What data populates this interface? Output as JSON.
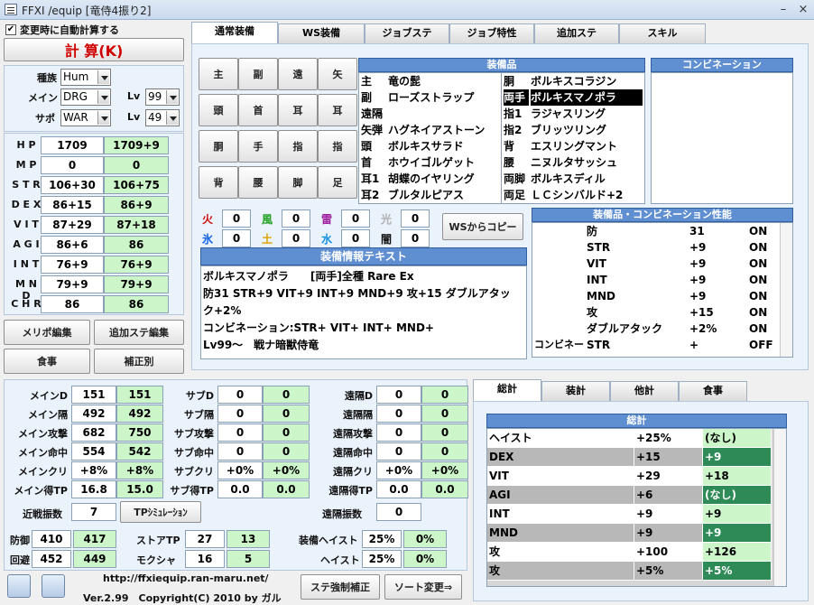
{
  "window": {
    "title": "FFXI /equip [竜侍4振り2]",
    "minimize": "–",
    "close": "×"
  },
  "top_left": {
    "auto_calc_label": "変更時に自動計算する",
    "auto_calc_checked": true,
    "calc_button": "計 算(K)"
  },
  "job": {
    "race_label": "種族",
    "race": "Hum",
    "main_label": "メイン",
    "main": "DRG",
    "sub_label": "サポ",
    "sub": "WAR",
    "lv_label": "Lv",
    "main_lv": "99",
    "sub_lv": "49"
  },
  "stats": [
    {
      "label": "H P",
      "base": "1709",
      "total": "1709+9"
    },
    {
      "label": "M P",
      "base": "0",
      "total": "0"
    },
    {
      "label": "S T R",
      "base": "106+30",
      "total": "106+75"
    },
    {
      "label": "D E X",
      "base": "86+15",
      "total": "86+9"
    },
    {
      "label": "V I T",
      "base": "87+29",
      "total": "87+18"
    },
    {
      "label": "A G I",
      "base": "86+6",
      "total": "86"
    },
    {
      "label": "I N T",
      "base": "76+9",
      "total": "76+9"
    },
    {
      "label": "M N D",
      "base": "79+9",
      "total": "79+9"
    },
    {
      "label": "C H R",
      "base": "86",
      "total": "86"
    }
  ],
  "left_buttons": {
    "merit": "メリポ編集",
    "extra": "追加ステ編集",
    "food": "食事",
    "correction": "補正別"
  },
  "tabs": [
    "通常装備",
    "WS装備",
    "ジョブステ",
    "ジョブ特性",
    "追加ステ",
    "スキル"
  ],
  "slot_buttons": [
    "主",
    "副",
    "遠",
    "矢",
    "頭",
    "首",
    "耳",
    "耳",
    "胴",
    "手",
    "指",
    "指",
    "背",
    "腰",
    "脚",
    "足"
  ],
  "equip": {
    "header": "装備品",
    "left": [
      {
        "slot": "主",
        "item": "竜の髭"
      },
      {
        "slot": "副",
        "item": "ローズストラップ"
      },
      {
        "slot": "遠隔",
        "item": ""
      },
      {
        "slot": "矢弾",
        "item": "ハグネイアストーン"
      },
      {
        "slot": "頭",
        "item": "ボルキスサラド"
      },
      {
        "slot": "首",
        "item": "ホウイゴルゲット"
      },
      {
        "slot": "耳1",
        "item": "胡蝶のイヤリング"
      },
      {
        "slot": "耳2",
        "item": "ブルタルピアス"
      }
    ],
    "right": [
      {
        "slot": "胴",
        "item": "ボルキスコラジン"
      },
      {
        "slot": "両手",
        "item": "ボルキスマノポラ",
        "selected": true
      },
      {
        "slot": "指1",
        "item": "ラジャスリング"
      },
      {
        "slot": "指2",
        "item": "ブリッツリング"
      },
      {
        "slot": "背",
        "item": "エスリングマント"
      },
      {
        "slot": "腰",
        "item": "ニヌルタサッシュ"
      },
      {
        "slot": "両脚",
        "item": "ボルキスディル"
      },
      {
        "slot": "両足",
        "item": "ＬＣシンバルド+2"
      }
    ]
  },
  "combination": {
    "header": "コンビネーション"
  },
  "elements": [
    {
      "name": "火",
      "value": "0",
      "color": "#d01010"
    },
    {
      "name": "風",
      "value": "0",
      "color": "#20a020"
    },
    {
      "name": "雷",
      "value": "0",
      "color": "#a020a0"
    },
    {
      "name": "光",
      "value": "0",
      "color": "#b0b0b0"
    },
    {
      "name": "氷",
      "value": "0",
      "color": "#1060e0"
    },
    {
      "name": "土",
      "value": "0",
      "color": "#e0a000"
    },
    {
      "name": "水",
      "value": "0",
      "color": "#1090e0"
    },
    {
      "name": "闇",
      "value": "0",
      "color": "#111111"
    }
  ],
  "ws_copy": "WSからコピー",
  "perf": {
    "header": "装備品・コンビネーション性能",
    "rows": [
      {
        "a": "",
        "b": "防",
        "c": "31",
        "d": "ON"
      },
      {
        "a": "",
        "b": "STR",
        "c": "+9",
        "d": "ON"
      },
      {
        "a": "",
        "b": "VIT",
        "c": "+9",
        "d": "ON"
      },
      {
        "a": "",
        "b": "INT",
        "c": "+9",
        "d": "ON"
      },
      {
        "a": "",
        "b": "MND",
        "c": "+9",
        "d": "ON"
      },
      {
        "a": "",
        "b": "攻",
        "c": "+15",
        "d": "ON"
      },
      {
        "a": "",
        "b": "ダブルアタック",
        "c": "+2%",
        "d": "ON"
      },
      {
        "a": "コンビネー",
        "b": "STR",
        "c": "+",
        "d": "OFF"
      }
    ]
  },
  "info": {
    "header": "装備情報テキスト",
    "lines": [
      "ボルキスマノポラ　　[両手]全種 Rare Ex",
      "防31 STR+9 VIT+9 INT+9 MND+9 攻+15 ダブルアタッ",
      "ク+2%",
      "コンビネーション:STR+ VIT+ INT+ MND+",
      "Lv99～　戦ナ暗獣侍竜"
    ]
  },
  "bottom_stats": {
    "main": [
      {
        "l": "メインD",
        "a": "151",
        "b": "151"
      },
      {
        "l": "メイン隔",
        "a": "492",
        "b": "492"
      },
      {
        "l": "メイン攻撃",
        "a": "682",
        "b": "750"
      },
      {
        "l": "メイン命中",
        "a": "554",
        "b": "542"
      },
      {
        "l": "メインクリ",
        "a": "+8%",
        "b": "+8%"
      },
      {
        "l": "メイン得TP",
        "a": "16.8",
        "b": "15.0"
      }
    ],
    "sub": [
      {
        "l": "サブD",
        "a": "0",
        "b": "0"
      },
      {
        "l": "サブ隔",
        "a": "0",
        "b": "0"
      },
      {
        "l": "サブ攻撃",
        "a": "0",
        "b": "0"
      },
      {
        "l": "サブ命中",
        "a": "0",
        "b": "0"
      },
      {
        "l": "サブクリ",
        "a": "+0%",
        "b": "+0%"
      },
      {
        "l": "サブ得TP",
        "a": "0.0",
        "b": "0.0"
      }
    ],
    "ranged": [
      {
        "l": "遠隔D",
        "a": "0",
        "b": "0"
      },
      {
        "l": "遠隔隔",
        "a": "0",
        "b": "0"
      },
      {
        "l": "遠隔攻撃",
        "a": "0",
        "b": "0"
      },
      {
        "l": "遠隔命中",
        "a": "0",
        "b": "0"
      },
      {
        "l": "遠隔クリ",
        "a": "+0%",
        "b": "+0%"
      },
      {
        "l": "遠隔得TP",
        "a": "0.0",
        "b": "0.0"
      }
    ],
    "melee_hits_label": "近戦振数",
    "melee_hits": "7",
    "tp_sim": "TPｼﾐｭﾚｰｼｮﾝ",
    "ranged_hits_label": "遠隔振数",
    "ranged_hits": "0",
    "def_label": "防御",
    "def_a": "410",
    "def_b": "417",
    "eva_label": "回避",
    "eva_a": "452",
    "eva_b": "449",
    "storetp_label": "ストアTP",
    "storetp_a": "27",
    "storetp_b": "13",
    "mokusha_label": "モクシャ",
    "mokusha_a": "16",
    "mokusha_b": "5",
    "eqhaste_label": "装備ヘイスト",
    "eqhaste_a": "25%",
    "eqhaste_b": "0%",
    "haste_label": "ヘイスト",
    "haste_a": "25%",
    "haste_b": "0%"
  },
  "footer": {
    "url": "http://ffxiequip.ran-maru.net/",
    "version": "Ver.2.99　Copyright(C) 2010 by ガル",
    "force_btn": "ステ強制補正",
    "sort_btn": "ソート変更⇒"
  },
  "summary_tabs": [
    "総計",
    "装計",
    "他計",
    "食事"
  ],
  "summary": {
    "header": "総計",
    "rows": [
      {
        "k": "ヘイスト",
        "v": "+25%",
        "o": "(なし)",
        "dark": false
      },
      {
        "k": "DEX",
        "v": "+15",
        "o": "+9",
        "dark": true
      },
      {
        "k": "VIT",
        "v": "+29",
        "o": "+18",
        "dark": false
      },
      {
        "k": "AGI",
        "v": "+6",
        "o": "(なし)",
        "dark": true
      },
      {
        "k": "INT",
        "v": "+9",
        "o": "+9",
        "dark": false
      },
      {
        "k": "MND",
        "v": "+9",
        "o": "+9",
        "dark": true
      },
      {
        "k": "攻",
        "v": "+100",
        "o": "+126",
        "dark": false
      },
      {
        "k": "攻",
        "v": "+5%",
        "o": "+5%",
        "dark": true
      }
    ]
  }
}
